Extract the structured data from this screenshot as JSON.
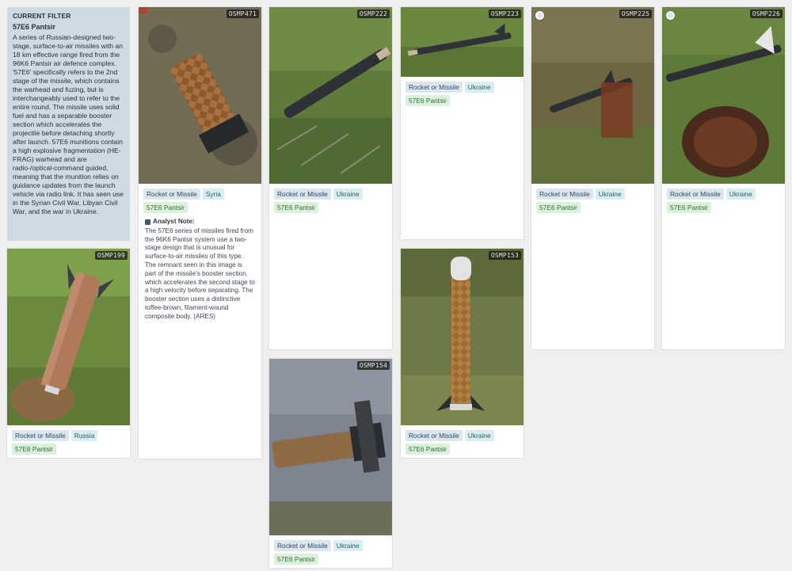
{
  "filter": {
    "heading": "CURRENT FILTER",
    "name": "57E6 Pantsir",
    "description": "A series of Russian-designed two-stage, surface-to-air missiles with an 18 km effective range fired from the 96K6 Pantsir air defence complex. '57E6' specifically refers to the 2nd stage of the missile, which contains the warhead and fuzing, but is interchangeably used to refer to the entire round. The missile uses solid fuel and has a separable booster section which accelerates the projectile before detaching shortly after launch. 57E6 munitions contain a high explosive fragmentation (HE-FRAG) warhead and are radio-/optical-command guided, meaning that the munition relies on guidance updates from the launch vehicle via radio link. It has seen use in the Syrian Civil War, Libyan Civil War, and the war in Ukraine."
  },
  "cards": {
    "c199": {
      "code": "OSMP199",
      "category": "Rocket or Missile",
      "country": "Russia",
      "munition": "57E6 Pantsir"
    },
    "c471": {
      "code": "OSMP471",
      "category": "Rocket or Missile",
      "country": "Syria",
      "munition": "57E6 Pantsir",
      "note_title": "Analyst Note:",
      "note_text": "The 57E6 series of missiles fired from the 96K6 Pantsir system use a two-stage design that is unusual for surface-to-air missiles of this type. The remnant seen in this image is part of the missile's booster section, which accelerates the second stage to a high velocity before separating. The booster section uses a distinctive toffee-brown, filament-wound composite body. (ARES)"
    },
    "c222": {
      "code": "OSMP222",
      "category": "Rocket or Missile",
      "country": "Ukraine",
      "munition": "57E6 Pantsir"
    },
    "c154": {
      "code": "OSMP154",
      "category": "Rocket or Missile",
      "country": "Ukraine",
      "munition": "57E6 Pantsir"
    },
    "c223": {
      "code": "OSMP223",
      "category": "Rocket or Missile",
      "country": "Ukraine",
      "munition": "57E6 Pantsir"
    },
    "c153": {
      "code": "OSMP153",
      "category": "Rocket or Missile",
      "country": "Ukraine",
      "munition": "57E6 Pantsir"
    },
    "c225": {
      "code": "OSMP225",
      "category": "Rocket or Missile",
      "country": "Ukraine",
      "munition": "57E6 Pantsir"
    },
    "c226": {
      "code": "OSMP226",
      "category": "Rocket or Missile",
      "country": "Ukraine",
      "munition": "57E6 Pantsir"
    }
  },
  "colors": {
    "background": "#efefef",
    "filter_panel": "#cfdbe2",
    "tag_category": "#dbe6ef",
    "tag_country": "#d8eef0",
    "tag_munition": "#dcf1dc"
  },
  "icons": {
    "note": "note-icon",
    "badge": "status-dot-icon"
  }
}
